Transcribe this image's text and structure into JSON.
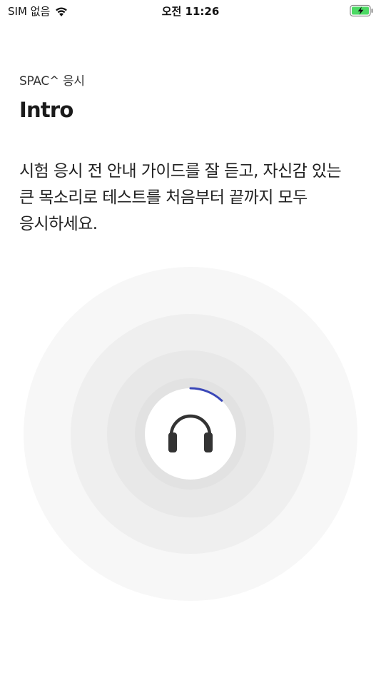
{
  "status_bar": {
    "carrier": "SIM 없음",
    "time": "오전 11:26",
    "wifi_icon": "wifi-icon",
    "battery_icon": "battery-charging-icon",
    "battery_color": "#4cd964"
  },
  "header": {
    "subtitle": "SPAC^ 응시",
    "title": "Intro"
  },
  "instruction": {
    "text": "시험 응시 전 안내 가이드를 잘 듣고, 자신감 있는\n큰 목소리로 테스트를 처음부터 끝까지 모두\n응시하세요."
  },
  "audio_visual": {
    "icon": "headphones-icon",
    "progress": 0.12,
    "progress_color": "#3a47b8",
    "ring_colors": [
      "#f7f7f7",
      "#efefef",
      "#e8e8e8",
      "#e2e2e2",
      "#ffffff"
    ]
  }
}
